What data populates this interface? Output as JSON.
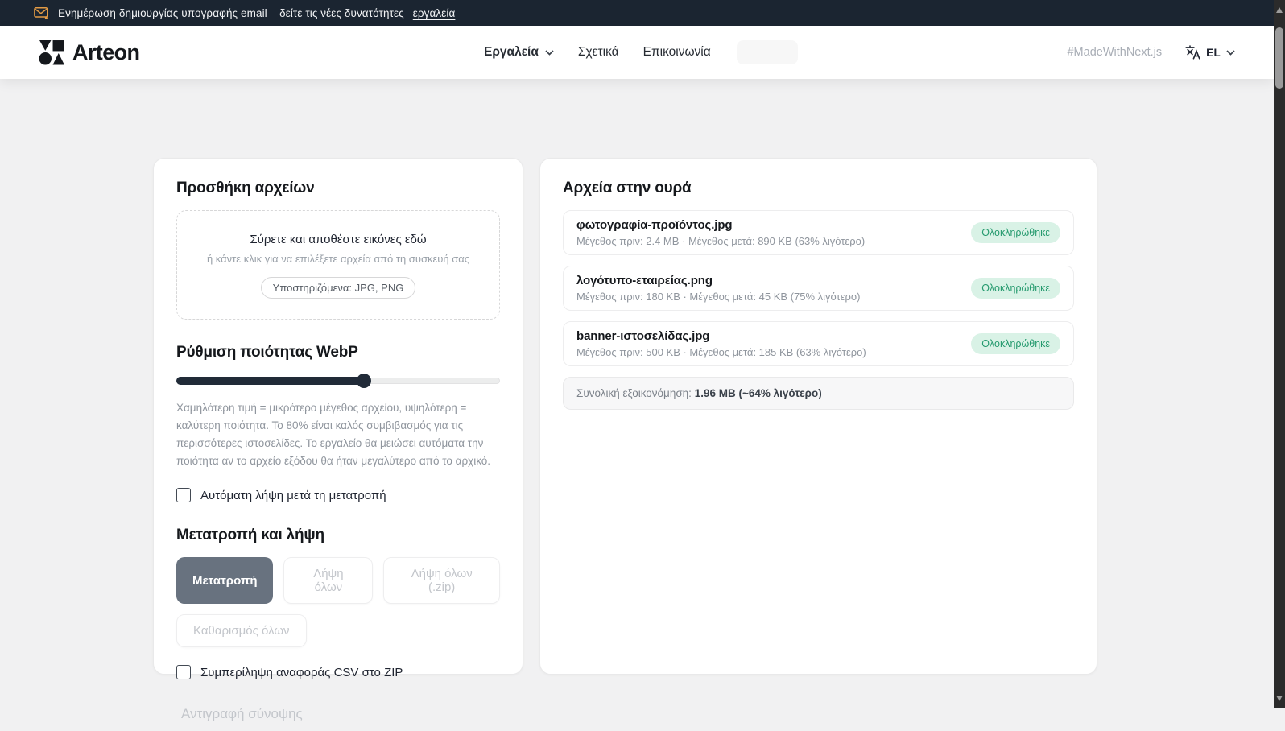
{
  "banner": {
    "text": "Ενημέρωση δημιουργίας υπογραφής email – δείτε τις νέες δυνατότητες",
    "link_label": "εργαλεία"
  },
  "header": {
    "brand": "Arteon",
    "nav": [
      {
        "label": "Εργαλεία",
        "has_dropdown": true,
        "active": true
      },
      {
        "label": "Σχετικά"
      },
      {
        "label": "Επικοινωνία"
      }
    ],
    "hashtag": "#MadeWithNext.js",
    "language": "EL"
  },
  "left_panel": {
    "title": "Προσθήκη αρχείων",
    "dropzone": {
      "line1": "Σύρετε και αποθέστε εικόνες εδώ",
      "line2": "ή κάντε κλικ για να επιλέξετε αρχεία από τη συσκευή σας",
      "formats_badge": "Υποστηριζόμενα: JPG, PNG"
    },
    "quality": {
      "title": "Ρύθμιση ποιότητας WebP",
      "slider_percent": 58,
      "description": "Χαμηλότερη τιμή = μικρότερο μέγεθος αρχείου, υψηλότερη = καλύτερη ποιότητα. Το 80% είναι καλός συμβιβασμός για τις περισσότερες ιστοσελίδες. Το εργαλείο θα μειώσει αυτόματα την ποιότητα αν το αρχείο εξόδου θα ήταν μεγαλύτερο από το αρχικό."
    },
    "auto_download_label": "Αυτόματη λήψη μετά τη μετατροπή",
    "auto_download_checked": false,
    "convert_section": {
      "title": "Μετατροπή και λήψη",
      "convert_label": "Μετατροπή",
      "download_all_label": "Λήψη όλων",
      "download_zip_label": "Λήψη όλων (.zip)",
      "clear_all_label": "Καθαρισμός όλων",
      "csv_label": "Συμπερίληψη αναφοράς CSV στο ZIP",
      "csv_checked": false,
      "copy_summary_label": "Αντιγραφή σύνοψης"
    }
  },
  "right_panel": {
    "title": "Αρχεία στην ουρά",
    "files": [
      {
        "name": "φωτογραφία-προϊόντος.jpg",
        "meta": "Μέγεθος πριν: 2.4 MB · Μέγεθος μετά: 890 KB (63% λιγότερο)",
        "status": "Ολοκληρώθηκε"
      },
      {
        "name": "λογότυπο-εταιρείας.png",
        "meta": "Μέγεθος πριν: 180 KB · Μέγεθος μετά: 45 KB (75% λιγότερο)",
        "status": "Ολοκληρώθηκε"
      },
      {
        "name": "banner-ιστοσελίδας.jpg",
        "meta": "Μέγεθος πριν: 500 KB · Μέγεθος μετά: 185 KB (63% λιγότερο)",
        "status": "Ολοκληρώθηκε"
      }
    ],
    "summary": {
      "label": "Συνολική εξοικονόμηση: ",
      "value": "1.96 MB (~64% λιγότερο)"
    }
  },
  "colors": {
    "banner_bg": "#1b2531",
    "accent_orange": "#e39b45",
    "slider_fill": "#212b38",
    "primary_button_bg": "#68727f",
    "badge_bg": "#d9f2e6",
    "badge_text": "#259a6e",
    "page_bg": "#f1f1f2"
  }
}
